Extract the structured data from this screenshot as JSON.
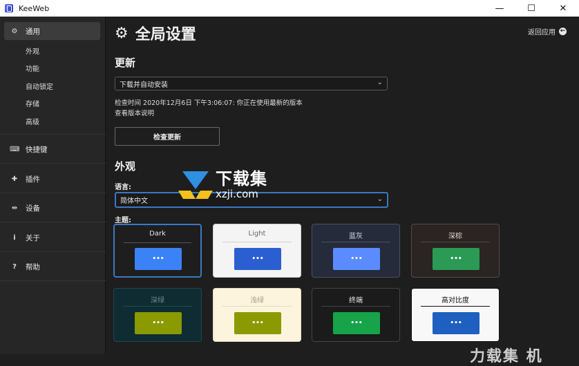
{
  "window": {
    "title": "KeeWeb",
    "minimize_label": "—",
    "maximize_label": "☐",
    "close_label": "✕"
  },
  "sidebar": {
    "general": "通用",
    "sub_items": [
      "外观",
      "功能",
      "自动锁定",
      "存储",
      "高级"
    ],
    "shortcuts": "快捷键",
    "plugins": "插件",
    "devices": "设备",
    "about": "关于",
    "help": "帮助"
  },
  "page": {
    "title": "全局设置",
    "back_label": "返回应用"
  },
  "updates": {
    "heading": "更新",
    "select_value": "下载并自动安装",
    "check_info": "检查时间 2020年12月6日 下午3:06:07: 你正在使用最新的版本",
    "release_notes": "查看版本说明",
    "check_button": "检查更新"
  },
  "appearance": {
    "heading": "外观",
    "language_label": "语言:",
    "language_value": "简体中文",
    "theme_label": "主题:",
    "themes": [
      {
        "name": "Dark",
        "preview": "•••",
        "selected": true,
        "bg": "#1e1e1e",
        "text": "#e8e8e8",
        "line": "#555555",
        "accent": "#3b82f6"
      },
      {
        "name": "Light",
        "preview": "•••",
        "selected": false,
        "bg": "#f4f4f4",
        "text": "#666666",
        "line": "#d0d0d0",
        "accent": "#2b5fd1"
      },
      {
        "name": "蓝灰",
        "preview": "•••",
        "selected": false,
        "bg": "#252b3a",
        "text": "#d8dce6",
        "line": "#4a5266",
        "accent": "#5a8cff"
      },
      {
        "name": "深棕",
        "preview": "•••",
        "selected": false,
        "bg": "#2a2422",
        "text": "#e6dcd6",
        "line": "#554a46",
        "accent": "#2a9a55"
      },
      {
        "name": "深绿",
        "preview": "•••",
        "selected": false,
        "bg": "#0f2c33",
        "text": "#6a8f8f",
        "line": "#24474e",
        "accent": "#8a9a00"
      },
      {
        "name": "浅绿",
        "preview": "•••",
        "selected": false,
        "bg": "#fdf4de",
        "text": "#9aa08a",
        "line": "#e6dcc0",
        "accent": "#8a9a00"
      },
      {
        "name": "终端",
        "preview": "•••",
        "selected": false,
        "bg": "#1b1b1b",
        "text": "#e8e8e8",
        "line": "#444444",
        "accent": "#16a34a"
      },
      {
        "name": "高对比度",
        "preview": "•••",
        "selected": false,
        "bg": "#f8f8f8",
        "text": "#111111",
        "line": "#111111",
        "accent": "#1f5fbf"
      }
    ]
  },
  "watermark": {
    "brand_cn": "下载集",
    "brand_url": "xzji.com",
    "corner_text": "力载集 机"
  },
  "colors": {
    "accent": "#3b78c4",
    "sidebar_bg": "#262626",
    "main_bg": "#1e1e1e"
  }
}
